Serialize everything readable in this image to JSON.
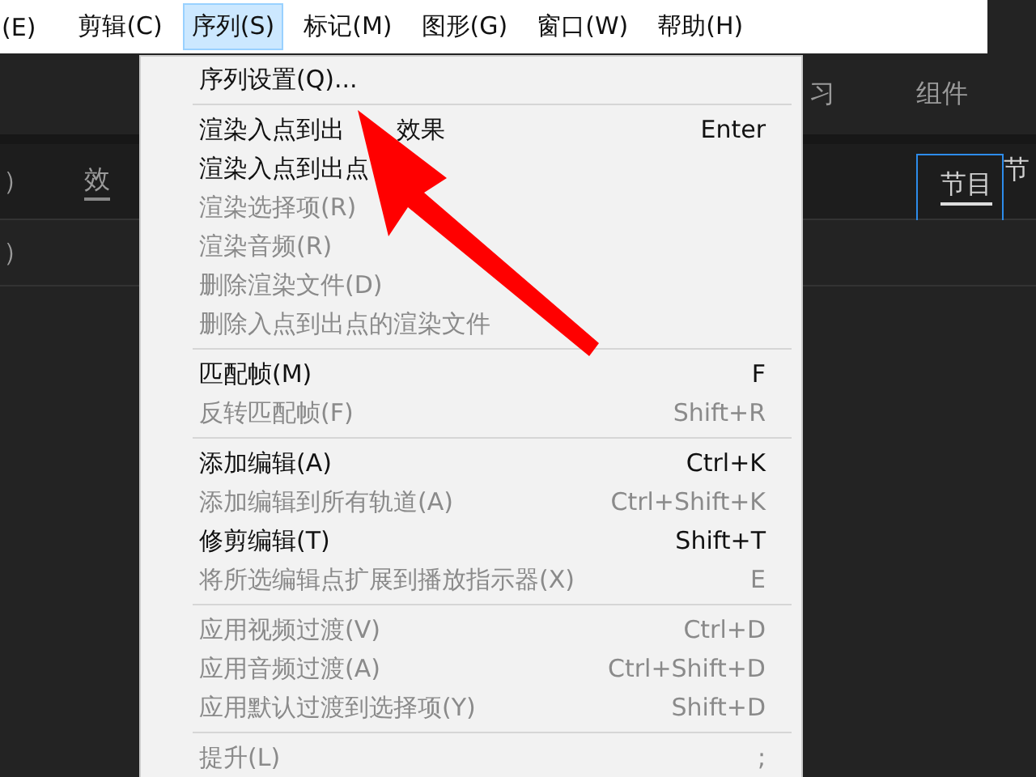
{
  "menubar": [
    {
      "label": "(E)",
      "selected": false
    },
    {
      "label": "剪辑(C)",
      "selected": false
    },
    {
      "label": "序列(S)",
      "selected": true
    },
    {
      "label": "标记(M)",
      "selected": false
    },
    {
      "label": "图形(G)",
      "selected": false
    },
    {
      "label": "窗口(W)",
      "selected": false
    },
    {
      "label": "帮助(H)",
      "selected": false
    }
  ],
  "panels": {
    "top_tabs": [
      "习",
      "组件"
    ],
    "left_tab": "效",
    "left_fragments": [
      "）",
      "）"
    ],
    "right_tab": "节目",
    "far_right_tab": "节"
  },
  "menu": {
    "groups": [
      [
        {
          "label": "序列设置(Q)...",
          "disabled": false
        }
      ],
      [
        {
          "label": "渲染入点到出",
          "label_tail": "效果",
          "shortcut": "Enter",
          "disabled": false
        },
        {
          "label": "渲染入点到出点",
          "disabled": false
        },
        {
          "label": "渲染选择项(R)",
          "disabled": true
        },
        {
          "label": "渲染音频(R)",
          "disabled": true
        },
        {
          "label": "删除渲染文件(D)",
          "disabled": true
        },
        {
          "label": "删除入点到出点的渲染文件",
          "disabled": true
        }
      ],
      [
        {
          "label": "匹配帧(M)",
          "shortcut": "F",
          "disabled": false
        },
        {
          "label": "反转匹配帧(F)",
          "shortcut": "Shift+R",
          "disabled": true
        }
      ],
      [
        {
          "label": "添加编辑(A)",
          "shortcut": "Ctrl+K",
          "disabled": false
        },
        {
          "label": "添加编辑到所有轨道(A)",
          "shortcut": "Ctrl+Shift+K",
          "disabled": true
        },
        {
          "label": "修剪编辑(T)",
          "shortcut": "Shift+T",
          "disabled": false
        },
        {
          "label": "将所选编辑点扩展到播放指示器(X)",
          "shortcut": "E",
          "disabled": true
        }
      ],
      [
        {
          "label": "应用视频过渡(V)",
          "shortcut": "Ctrl+D",
          "disabled": true
        },
        {
          "label": "应用音频过渡(A)",
          "shortcut": "Ctrl+Shift+D",
          "disabled": true
        },
        {
          "label": "应用默认过渡到选择项(Y)",
          "shortcut": "Shift+D",
          "disabled": true
        }
      ],
      [
        {
          "label": "提升(L)",
          "shortcut": ";",
          "disabled": true
        }
      ]
    ]
  }
}
